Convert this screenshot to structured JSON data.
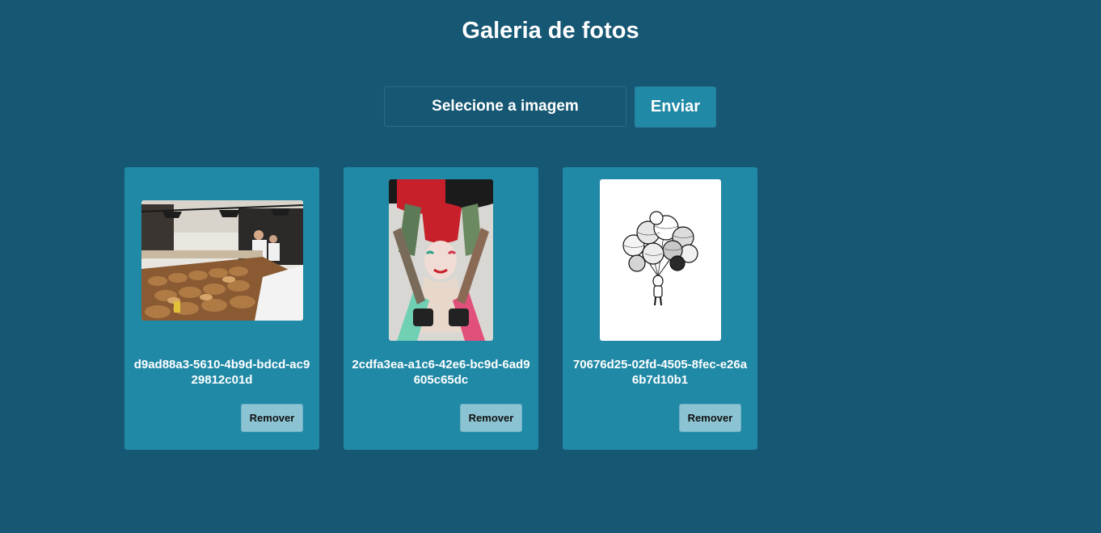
{
  "header": {
    "title": "Galeria de fotos"
  },
  "upload": {
    "file_label": "Selecione a imagem",
    "submit_label": "Enviar"
  },
  "gallery": {
    "items": [
      {
        "caption": "d9ad88a3-5610-4b9d-bdcd-ac929812c01d",
        "remove_label": "Remover",
        "image": "bakery-shop-photo"
      },
      {
        "caption": "2cdfa3ea-a1c6-42e6-bc9d-6ad9605c65dc",
        "remove_label": "Remover",
        "image": "harley-quinn-cosplay-photo"
      },
      {
        "caption": "70676d25-02fd-4505-8fec-e26a6b7d10b1",
        "remove_label": "Remover",
        "image": "astronaut-planet-balloons-illustration"
      }
    ]
  },
  "colors": {
    "background": "#165773",
    "card": "#2089a6",
    "button": "#2089a6",
    "remove_button": "#8bc3d3",
    "text": "#ffffff"
  }
}
